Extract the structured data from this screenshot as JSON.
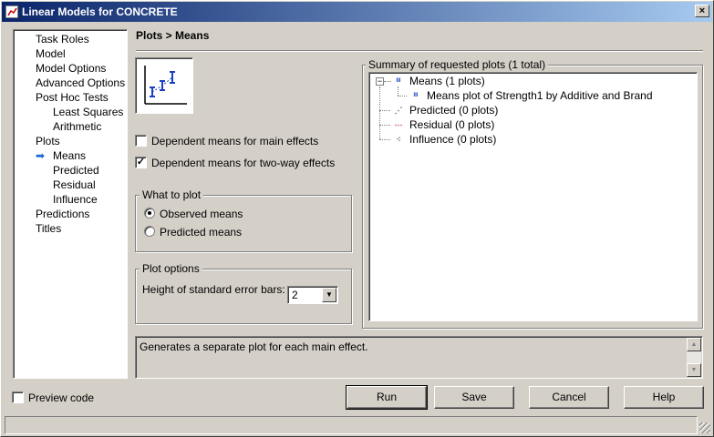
{
  "window": {
    "title": "Linear Models for CONCRETE",
    "close_label": "×"
  },
  "nav": {
    "items": [
      {
        "label": "Task Roles"
      },
      {
        "label": "Model"
      },
      {
        "label": "Model Options"
      },
      {
        "label": "Advanced Options"
      },
      {
        "label": "Post Hoc Tests"
      },
      {
        "label": "Least Squares"
      },
      {
        "label": "Arithmetic"
      },
      {
        "label": "Plots"
      },
      {
        "label": "Means"
      },
      {
        "label": "Predicted"
      },
      {
        "label": "Residual"
      },
      {
        "label": "Influence"
      },
      {
        "label": "Predictions"
      },
      {
        "label": "Titles"
      }
    ],
    "selected": "Means",
    "arrow_glyph": "➡"
  },
  "header": {
    "title": "Plots > Means"
  },
  "options": {
    "main_effects_label": "Dependent means for main effects",
    "main_effects_checked": false,
    "two_way_label": "Dependent means for two-way effects",
    "two_way_checked": true
  },
  "what_to_plot": {
    "legend": "What to plot",
    "observed_label": "Observed means",
    "predicted_label": "Predicted means",
    "selected": "Observed means"
  },
  "plot_options": {
    "legend": "Plot options",
    "height_label": "Height of standard error bars:",
    "height_value": "2"
  },
  "summary": {
    "legend": "Summary of requested plots (1 total)",
    "expander": "−",
    "means_label": "Means (1 plots)",
    "means_child_label": "Means plot of Strength1 by Additive and Brand",
    "predicted_label": "Predicted (0 plots)",
    "residual_label": "Residual (0 plots)",
    "influence_label": "Influence (0 plots)"
  },
  "description": {
    "text": "Generates a separate plot for each main effect."
  },
  "footer": {
    "preview_label": "Preview code",
    "run_label": "Run",
    "save_label": "Save",
    "cancel_label": "Cancel",
    "help_label": "Help"
  },
  "colors": {
    "titlebar_start": "#0a246a",
    "titlebar_end": "#a6caf0",
    "window_bg": "#d4d0c8",
    "icon_blue": "#1a3fc4"
  }
}
